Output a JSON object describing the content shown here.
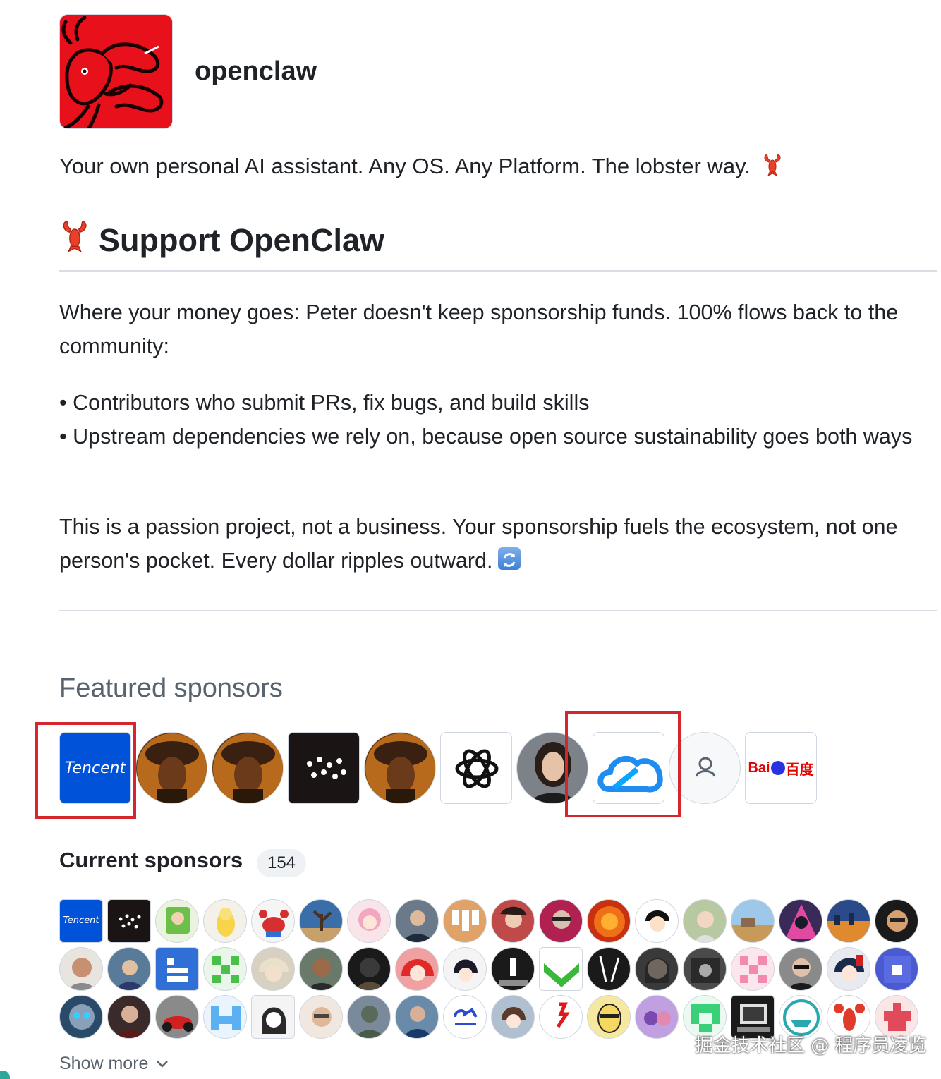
{
  "org": {
    "name": "openclaw",
    "logo_icon": "lobster-logo",
    "logo_bg": "#e8101a"
  },
  "tagline": "Your own personal AI assistant. Any OS. Any Platform. The lobster way.",
  "support": {
    "title": "Support OpenClaw",
    "intro": "Where your money goes: Peter doesn't keep sponsorship funds. 100% flows back to the community:",
    "bullets": [
      "Contributors who submit PRs, fix bugs, and build skills",
      "Upstream dependencies we rely on, because open source sustainability goes both ways"
    ],
    "closing": "This is a passion project, not a business. Your sponsorship fuels the ecosystem, not one person's pocket. Every dollar ripples outward."
  },
  "featured": {
    "title": "Featured sponsors",
    "items": [
      {
        "name": "Tencent",
        "label": "Tencent",
        "shape": "square",
        "icon": "tencent-logo",
        "highlighted": true
      },
      {
        "name": "portrait-sponsor-1",
        "shape": "round",
        "icon": "portrait-avatar"
      },
      {
        "name": "portrait-sponsor-2",
        "shape": "round",
        "icon": "portrait-avatar"
      },
      {
        "name": "dots-sponsor",
        "shape": "square",
        "icon": "dots-logo"
      },
      {
        "name": "portrait-sponsor-3",
        "shape": "round",
        "icon": "portrait-avatar"
      },
      {
        "name": "OpenAI",
        "shape": "square",
        "icon": "openai-logo"
      },
      {
        "name": "woman-sponsor",
        "shape": "round",
        "icon": "person-avatar"
      },
      {
        "name": "Tencent Cloud",
        "shape": "square",
        "icon": "cloud-logo",
        "highlighted": true
      },
      {
        "name": "ghost-sponsor",
        "shape": "round",
        "icon": "person-outline-icon"
      },
      {
        "name": "Baidu",
        "label_a": "Bai",
        "label_b": "百度",
        "shape": "square",
        "icon": "baidu-logo"
      }
    ]
  },
  "current": {
    "title": "Current sponsors",
    "count": "154"
  },
  "show_more": "Show more",
  "watermark": "掘金技术社区 @ 程序员凌览",
  "colors": {
    "highlight": "#d5262b",
    "tencent_blue": "#0052d9",
    "cloud_blue": "#1e8cf0",
    "baidu_red": "#e10602",
    "baidu_blue": "#2932e1"
  }
}
